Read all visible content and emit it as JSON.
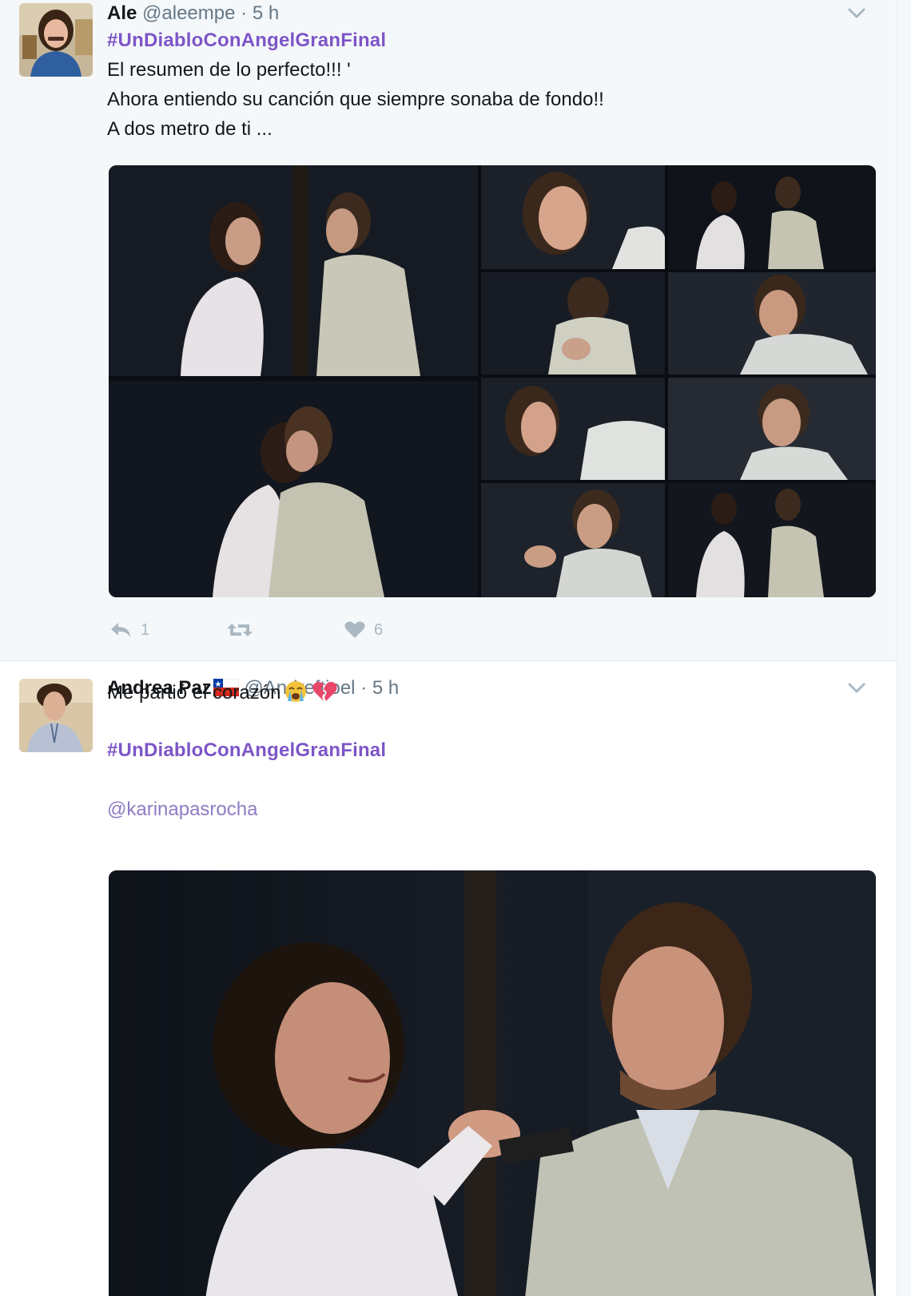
{
  "tweets": [
    {
      "fullname": "Ale",
      "screen_name": "@aleempe",
      "separator": "·",
      "time": "5 h",
      "lines": [
        "#UnDiabloConAngelGranFinal",
        "El resumen de lo perfecto!!!  '",
        "Ahora entiendo su canción que siempre sonaba de fondo!!",
        "A dos metro de ti ..."
      ],
      "actions": {
        "reply_count": "1",
        "retweet_count": "",
        "like_count": "6"
      },
      "media_icon": "photo-collage"
    },
    {
      "fullname": "Andrea Paz",
      "screen_name": "@Andreftjoel",
      "separator": "·",
      "time": "5 h",
      "lines": [
        "Me partió el corazón",
        "#UnDiabloConAngelGranFinal",
        "@karinapasrocha"
      ],
      "emojis": [
        "crying-face-icon",
        "broken-heart-icon"
      ],
      "flag_icon": "chile-flag-icon",
      "media_icon": "photo"
    }
  ],
  "colors": {
    "hashtag": "#7d55c7",
    "mention": "#8e7cc3",
    "muted": "#657786",
    "action": "#aab8c2",
    "tweet_bg_selected": "#f5f8fa"
  }
}
